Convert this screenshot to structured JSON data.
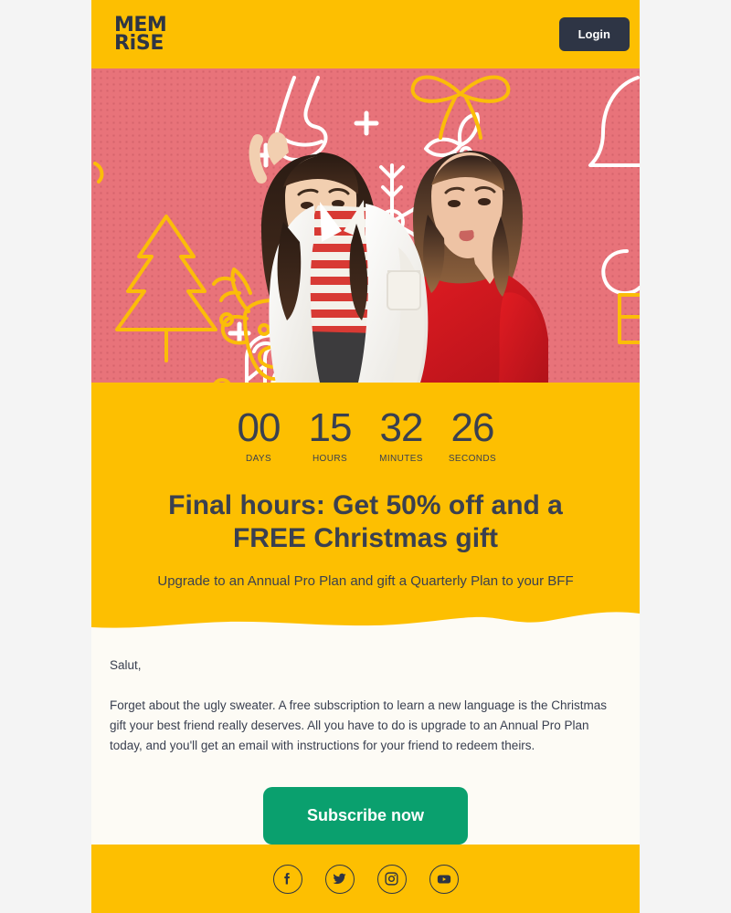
{
  "page": {
    "background": "#f4f4f4",
    "email_background": "#fdfbf5"
  },
  "colors": {
    "brand_yellow": "#fdbf01",
    "dark_navy": "#2e3545",
    "text": "#3a4050",
    "cta_green": "#0aa06e",
    "hero_coral": "#e8737a",
    "hero_coral_dots": "#d2606a",
    "doodle_white": "#ffffff",
    "doodle_yellow": "#fbbd08"
  },
  "header": {
    "logo_line1": "MEM",
    "logo_line2": "RiSE",
    "login_label": "Login"
  },
  "hero": {
    "alt": "Two young women celebrating in front of a coral wall with Christmas line-art doodles",
    "doodles": [
      "stocking",
      "snowflake",
      "christmas-tree",
      "reindeer",
      "candy-cane",
      "gingerbread-man",
      "holly",
      "bow",
      "bell",
      "gift",
      "plus",
      "circle"
    ]
  },
  "countdown": {
    "units": [
      {
        "value": "00",
        "label": "DAYS"
      },
      {
        "value": "15",
        "label": "HOURS"
      },
      {
        "value": "32",
        "label": "MINUTES"
      },
      {
        "value": "26",
        "label": "SECONDS"
      }
    ]
  },
  "promo": {
    "headline": "Final hours: Get 50% off and a FREE Christmas gift",
    "subheadline": "Upgrade to an Annual Pro Plan and gift a Quarterly Plan to your BFF"
  },
  "body": {
    "greeting": "Salut,",
    "paragraph": "Forget about the ugly sweater. A free subscription to learn a new language is the Christmas gift your best friend really deserves. All you have to do is upgrade to an Annual Pro Plan today, and you'll get an email with instructions for your friend to redeem theirs.",
    "cta_label": "Subscribe now"
  },
  "footer": {
    "social": [
      {
        "name": "facebook",
        "label": "Facebook"
      },
      {
        "name": "twitter",
        "label": "Twitter"
      },
      {
        "name": "instagram",
        "label": "Instagram"
      },
      {
        "name": "youtube",
        "label": "YouTube"
      }
    ]
  }
}
